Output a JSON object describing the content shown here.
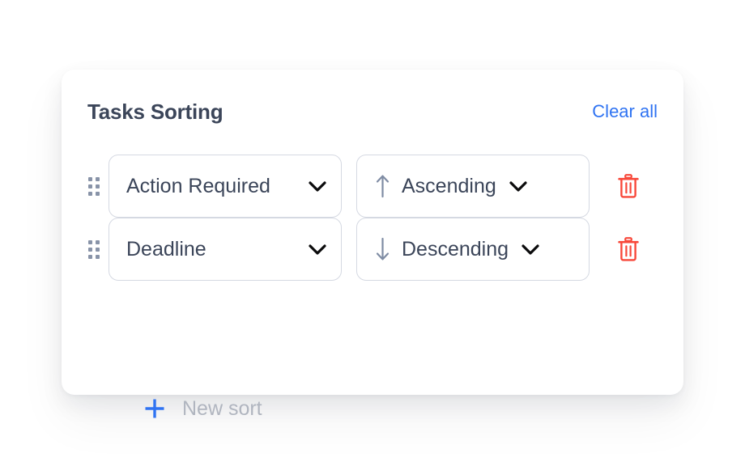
{
  "card": {
    "title": "Tasks Sorting",
    "clear_all_label": "Clear all",
    "accent_blue": "#2f73f2",
    "danger_red": "#f8483a",
    "title_color": "#3b4559",
    "border_color": "#d5d9e2",
    "handle_color": "#8893a8",
    "placeholder_color": "#b0b5bf"
  },
  "sort_rows": [
    {
      "drag_handle_icon": "drag-dots-icon",
      "field": {
        "value": "Action Required",
        "chevron_icon": "chevron-down-icon"
      },
      "direction": {
        "value": "Ascending",
        "arrow_icon": "arrow-up-icon",
        "chevron_icon": "chevron-down-icon"
      },
      "delete_icon": "trash-icon"
    },
    {
      "drag_handle_icon": "drag-dots-icon",
      "field": {
        "value": "Deadline",
        "chevron_icon": "chevron-down-icon"
      },
      "direction": {
        "value": "Descending",
        "arrow_icon": "arrow-down-icon",
        "chevron_icon": "chevron-down-icon"
      },
      "delete_icon": "trash-icon"
    }
  ],
  "new_sort": {
    "label": "New sort",
    "plus_icon": "plus-icon"
  }
}
